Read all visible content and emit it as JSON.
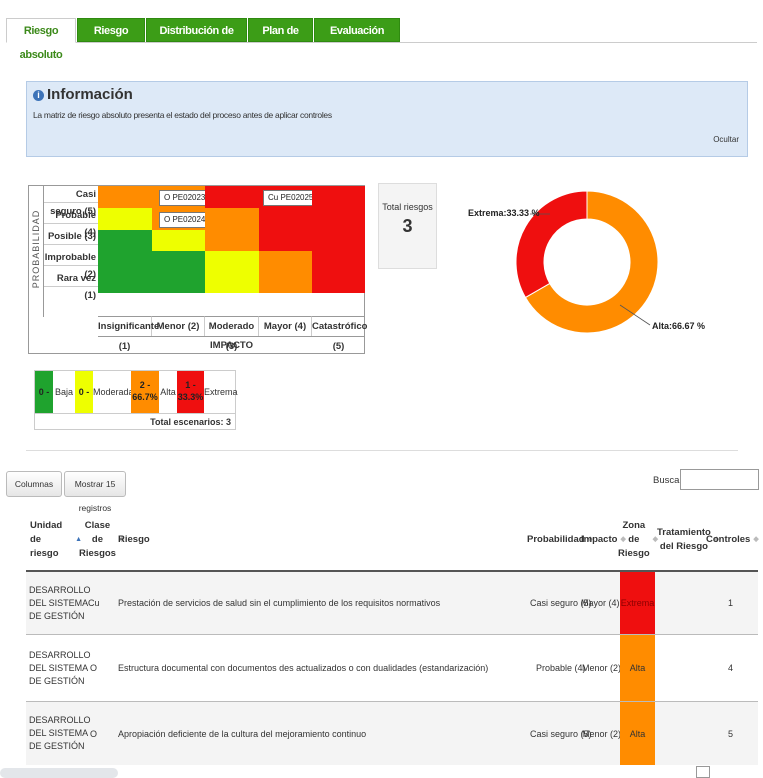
{
  "tabs": [
    "Riesgo absoluto",
    "Riesgo residual",
    "Distribución de escenarios",
    "Plan de acción",
    "Evaluación Controles"
  ],
  "info": {
    "title": "Información",
    "text": "La matriz de riesgo absoluto presenta el estado del proceso antes de aplicar controles",
    "hide_label": "Ocultar"
  },
  "matrix": {
    "axis_y": "PROBABILIDAD",
    "axis_x": "IMPACTO",
    "rows": [
      "Casi seguro (5)",
      "Probable (4)",
      "Posible (3)",
      "Improbable (2)",
      "Rara vez (1)"
    ],
    "columns": [
      "Insignificante (1)",
      "Menor (2)",
      "Moderado (3)",
      "Mayor (4)",
      "Catastrófico (5)"
    ],
    "codes": {
      "pe02023": "O  PE02023",
      "pe02025": "Cu  PE02025",
      "pe02024": "O  PE02024"
    },
    "colors": {
      "green": "#1fa32e",
      "yellow": "#eeff00",
      "orange": "#ff8c00",
      "red": "#ef0f0f"
    }
  },
  "total": {
    "label": "Total riesgos",
    "value": "3"
  },
  "donut": {
    "extrema_label": "Extrema:33.33 %",
    "alta_label": "Alta:66.67 %"
  },
  "chart_data": {
    "type": "pie",
    "categories": [
      "Extrema",
      "Alta"
    ],
    "values": [
      33.33,
      66.67
    ],
    "colors": [
      "#ef0f0f",
      "#ff8c00"
    ]
  },
  "legend": {
    "items": [
      {
        "count": "0 -",
        "label": "Baja",
        "color": "#1fa32e"
      },
      {
        "count": "0 -",
        "label": "Moderada",
        "color": "#eeff00"
      },
      {
        "count": "2 - 66.7%",
        "label": "Alta",
        "color": "#ff8c00"
      },
      {
        "count": "1 - 33.3%",
        "label": "Extrema",
        "color": "#ef0f0f"
      }
    ],
    "total": "Total escenarios: 3"
  },
  "toolbar": {
    "columns_label": "Columnas",
    "show_label": "Mostrar 15 registros",
    "search_label": "Buscar:",
    "search_value": ""
  },
  "table": {
    "headers": [
      "Unidad de riesgo",
      "Clase de Riesgos",
      "Riesgo",
      "Probabilidad",
      "Impacto",
      "Zona de Riesgo",
      "Tratamiento del Riesgo",
      "Controles"
    ],
    "rows": [
      {
        "unidad": "DESARROLLO DEL SISTEMA DE GESTIÓN",
        "clase": "Cu",
        "riesgo": "Prestación de servicios de salud sin el cumplimiento de los requisitos normativos",
        "prob": "Casi seguro (5)",
        "impacto": "Mayor (4)",
        "zona": "Extrema",
        "zona_color": "#ef0f0f",
        "tratamiento": "",
        "controles": "1"
      },
      {
        "unidad": "DESARROLLO DEL SISTEMA DE GESTIÓN",
        "clase": "O",
        "riesgo": "Estructura documental con documentos des actualizados o con dualidades (estandarización)",
        "prob": "Probable (4)",
        "impacto": "Menor (2)",
        "zona": "Alta",
        "zona_color": "#ff8c00",
        "tratamiento": "",
        "controles": "4"
      },
      {
        "unidad": "DESARROLLO DEL SISTEMA DE GESTIÓN",
        "clase": "O",
        "riesgo": "Apropiación deficiente de la cultura del mejoramiento continuo",
        "prob": "Casi seguro (5)",
        "impacto": "Menor (2)",
        "zona": "Alta",
        "zona_color": "#ff8c00",
        "tratamiento": "",
        "controles": "5"
      }
    ]
  }
}
